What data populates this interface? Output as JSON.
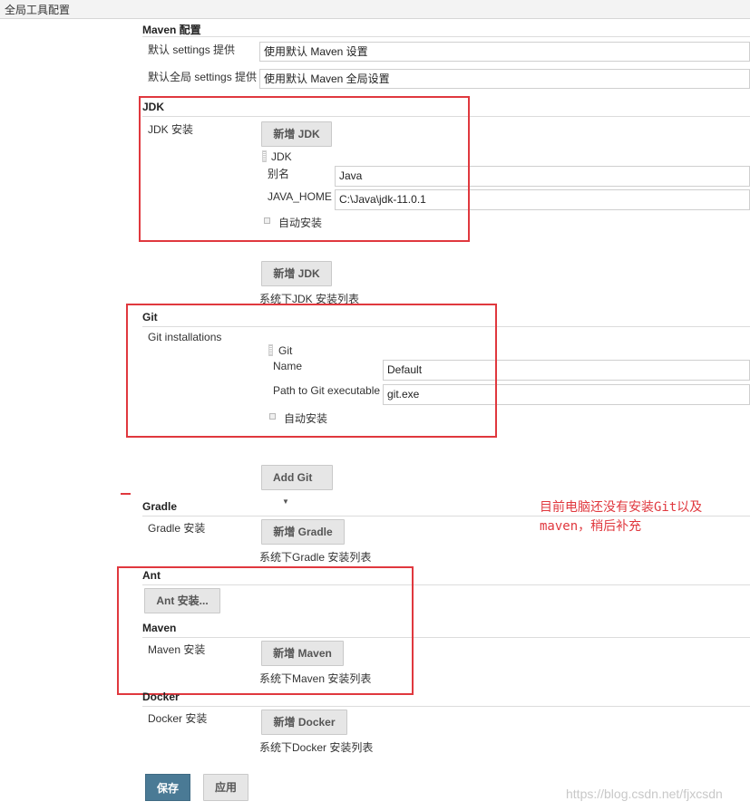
{
  "header": {
    "title": "全局工具配置"
  },
  "maven_config": {
    "title": "Maven 配置",
    "settings_label": "默认 settings 提供",
    "settings_value": "使用默认 Maven 设置",
    "global_settings_label": "默认全局 settings 提供",
    "global_settings_value": "使用默认 Maven 全局设置"
  },
  "jdk": {
    "title": "JDK",
    "install_label": "JDK 安装",
    "add_button": "新增 JDK",
    "item_title": "JDK",
    "alias_label": "别名",
    "alias_value": "Java",
    "home_label": "JAVA_HOME",
    "home_value": "C:\\Java\\jdk-11.0.1",
    "auto_install": "自动安装",
    "add_button_2": "新增 JDK",
    "list_caption": "系统下JDK 安装列表"
  },
  "git": {
    "title": "Git",
    "installations_label": "Git installations",
    "item_title": "Git",
    "name_label": "Name",
    "name_value": "Default",
    "path_label": "Path to Git executable",
    "path_value": "git.exe",
    "auto_install": "自动安装",
    "add_button": "Add Git"
  },
  "gradle": {
    "title": "Gradle",
    "install_label": "Gradle 安装",
    "add_button": "新增 Gradle",
    "list_caption": "系统下Gradle 安装列表"
  },
  "ant": {
    "title": "Ant",
    "install_button": "Ant 安装..."
  },
  "maven": {
    "title": "Maven",
    "install_label": "Maven 安装",
    "add_button": "新增 Maven",
    "list_caption": "系统下Maven 安装列表"
  },
  "docker": {
    "title": "Docker",
    "install_label": "Docker 安装",
    "add_button": "新增 Docker",
    "list_caption": "系统下Docker 安装列表"
  },
  "footer": {
    "save_button": "保存",
    "apply_button": "应用"
  },
  "annotation": {
    "line1": "目前电脑还没有安装Git以及",
    "line2": "maven，稍后补充"
  },
  "watermark": "https://blog.csdn.net/fjxcsdn",
  "colors": {
    "annotation_red": "#e0383e",
    "save_button": "#4a7a95"
  }
}
